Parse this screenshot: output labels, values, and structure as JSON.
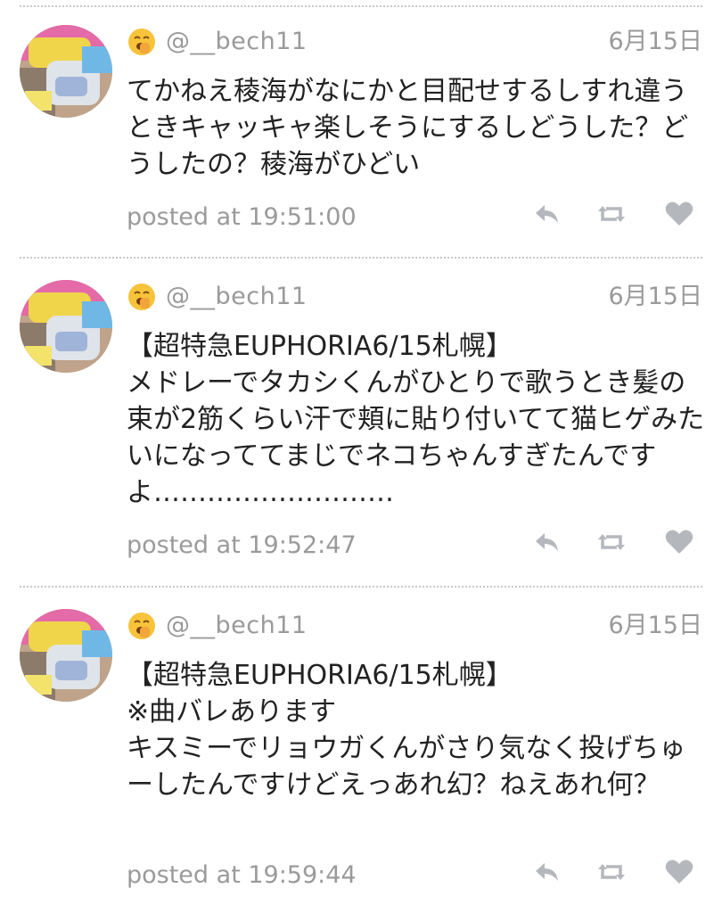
{
  "feed": {
    "tweets": [
      {
        "handle": "@__bech11",
        "date": "6月15日",
        "text": "てかねえ稜海がなにかと目配せするしすれ違うときキャッキャ楽しそうにするしどうした？どうしたの？稜海がひどい",
        "posted": "posted at 19:51:00",
        "emoji": "yawning-face-icon"
      },
      {
        "handle": "@__bech11",
        "date": "6月15日",
        "text": "【超特急EUPHORIA6/15札幌】\nメドレーでタカシくんがひとりで歌うとき髪の束が2筋くらい汗で頬に貼り付いてて猫ヒゲみたいになっててまじでネコちゃんすぎたんですよ………………………",
        "posted": "posted at 19:52:47",
        "emoji": "yawning-face-icon"
      },
      {
        "handle": "@__bech11",
        "date": "6月15日",
        "text": "【超特急EUPHORIA6/15札幌】\n※曲バレあります\nキスミーでリョウガくんがさり気なく投げちゅーしたんですけどえっあれ幻？ねえあれ何？",
        "posted": "posted at 19:59:44",
        "emoji": "yawning-face-icon"
      }
    ]
  },
  "icons": {
    "reply": "reply-icon",
    "retweet": "retweet-icon",
    "like": "heart-icon"
  },
  "colors": {
    "text": "#222222",
    "muted": "#9a9a9a",
    "icon": "#b4b8bd",
    "divider": "#c8c8c8"
  }
}
